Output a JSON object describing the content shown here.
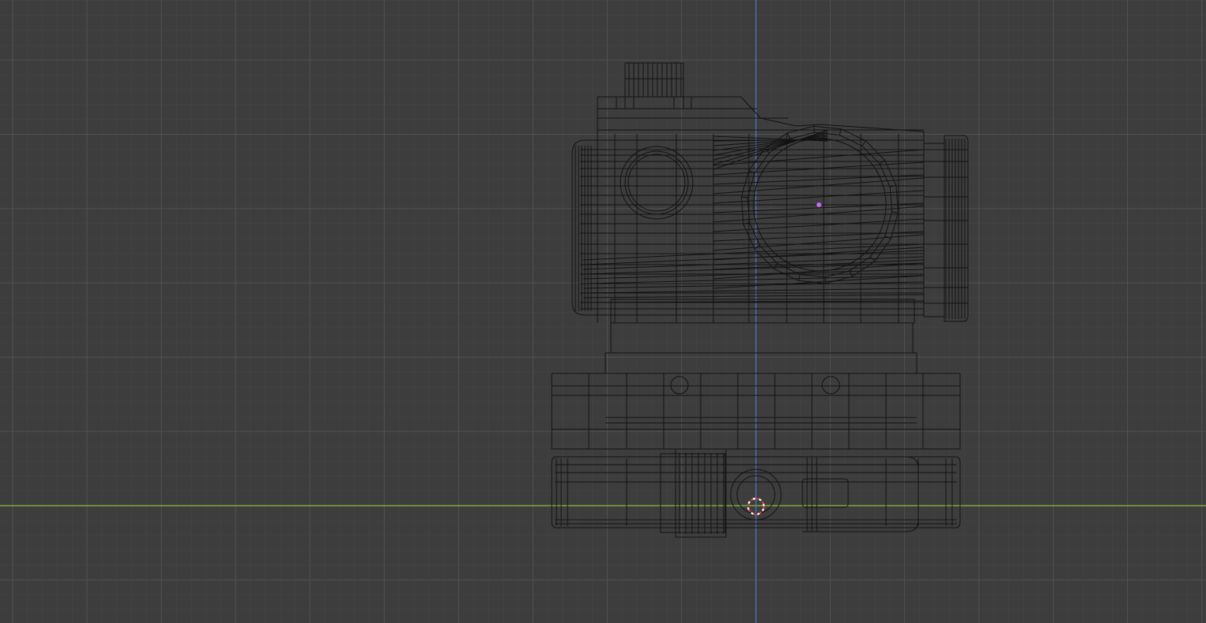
{
  "viewport": {
    "view": "wireframe",
    "background_color": "#3d3d3d",
    "grid_minor_color": "#474747",
    "grid_major_color": "#525252",
    "x_axis_color": "#8dbd3a",
    "z_axis_color": "#4f7ad0",
    "wire_color": "#121212",
    "origin_color": "#c86bff",
    "cursor_color": "#e23a3a"
  },
  "scene": {
    "object": "red-dot-sight",
    "selected": true,
    "cursor_visible": true
  }
}
